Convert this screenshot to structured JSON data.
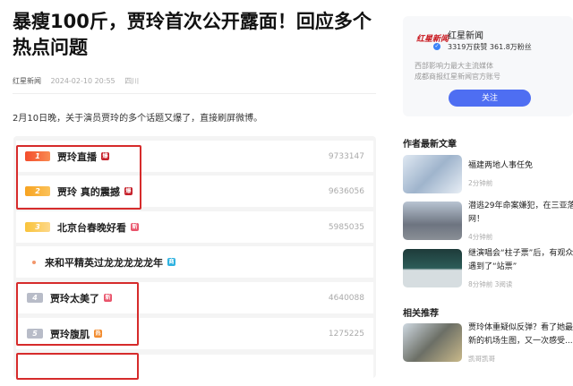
{
  "article": {
    "title": "暴瘦100斤，贾玲首次公开露面！回应多个热点问题",
    "source": "红星新闻",
    "datetime": "2024-02-10 20:55",
    "location": "四川",
    "paragraph": "2月10日晚，关于演员贾玲的多个话题又爆了，直接刷屏微博。"
  },
  "hot_list": [
    {
      "rank": "1",
      "title": "贾玲直播",
      "badge": "爆",
      "badge_color": "#c6202a",
      "count": "9733147"
    },
    {
      "rank": "2",
      "title": "贾玲 真的震撼",
      "badge": "爆",
      "badge_color": "#c6202a",
      "count": "9636056"
    },
    {
      "rank": "3",
      "title": "北京台春晚好看",
      "badge": "新",
      "badge_color": "#e9546b",
      "count": "5985035"
    },
    {
      "rank": "",
      "title": "来和平精英过龙龙龙龙龙年",
      "badge": "商",
      "badge_color": "#2fb2e0",
      "count": ""
    },
    {
      "rank": "4",
      "title": "贾玲太美了",
      "badge": "新",
      "badge_color": "#e9546b",
      "count": "4640088"
    },
    {
      "rank": "5",
      "title": "贾玲腹肌",
      "badge": "热",
      "badge_color": "#f28b2e",
      "count": "1275225"
    }
  ],
  "author_card": {
    "logo": "红星新闻",
    "name": "红星新闻",
    "stats": "3319万获赞 361.8万粉丝",
    "desc_line1": "西部影响力最大主流媒体",
    "desc_line2": "成都商报红星新闻官方账号",
    "follow_label": "关注"
  },
  "latest_section": "作者最新文章",
  "latest_articles": [
    {
      "title": "福建两地人事任免",
      "meta": "2分钟前"
    },
    {
      "title": "潜逃29年命案嫌犯，在三亚落网！",
      "meta": "4分钟前"
    },
    {
      "title": "继演唱会“柱子票”后，有观众遇到了“站票”",
      "meta": "8分钟前  3阅读"
    }
  ],
  "related_section": "相关推荐",
  "related_articles": [
    {
      "title": "贾玲体重疑似反弹？看了她最新的机场生图，又一次感受...",
      "meta": "凯哥凯哥"
    }
  ]
}
